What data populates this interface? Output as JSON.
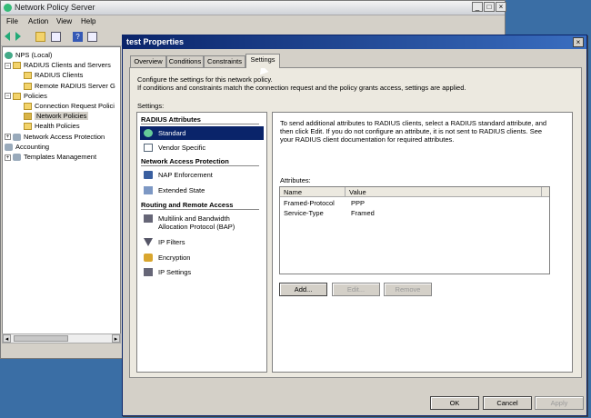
{
  "main_window": {
    "title": "Network Policy Server",
    "controls": {
      "minimize": "_",
      "maximize": "□",
      "close": "×"
    },
    "menu": [
      "File",
      "Action",
      "View",
      "Help"
    ],
    "tree": [
      {
        "label": "NPS (Local)",
        "icon": "server-icon",
        "expander": ""
      },
      {
        "label": "RADIUS Clients and Servers",
        "icon": "folder-icon",
        "expander": "−"
      },
      {
        "label": "RADIUS Clients",
        "icon": "folder-icon",
        "expander": ""
      },
      {
        "label": "Remote RADIUS Server G",
        "icon": "folder-icon",
        "expander": ""
      },
      {
        "label": "Policies",
        "icon": "folder-icon",
        "expander": "−"
      },
      {
        "label": "Connection Request Polici",
        "icon": "folder-icon",
        "expander": ""
      },
      {
        "label": "Network Policies",
        "icon": "folder-icon",
        "expander": ""
      },
      {
        "label": "Health Policies",
        "icon": "folder-icon",
        "expander": ""
      },
      {
        "label": "Network Access Protection",
        "icon": "gear-icon",
        "expander": "+"
      },
      {
        "label": "Accounting",
        "icon": "gear-icon",
        "expander": ""
      },
      {
        "label": "Templates Management",
        "icon": "gear-icon",
        "expander": "+"
      }
    ]
  },
  "dialog": {
    "title": "test Properties",
    "close": "×",
    "tabs": [
      "Overview",
      "Conditions",
      "Constraints",
      "Settings"
    ],
    "active_tab": "Settings",
    "intro_line1": "Configure the settings for this network policy.",
    "intro_line2": "If conditions and constraints match the connection request and the policy grants access, settings are applied.",
    "settings_label": "Settings:",
    "sections": [
      {
        "header": "RADIUS Attributes",
        "items": [
          {
            "label": "Standard",
            "icon": "globe-icon",
            "selected": true
          },
          {
            "label": "Vendor Specific",
            "icon": "checkbox-icon",
            "selected": false
          }
        ]
      },
      {
        "header": "Network Access Protection",
        "items": [
          {
            "label": "NAP Enforcement",
            "icon": "shield-icon",
            "selected": false
          },
          {
            "label": "Extended State",
            "icon": "monitor-icon",
            "selected": false
          }
        ]
      },
      {
        "header": "Routing and Remote Access",
        "items": [
          {
            "label": "Multilink and Bandwidth",
            "label2": "Allocation Protocol (BAP)",
            "icon": "network-icon",
            "selected": false
          },
          {
            "label": "IP Filters",
            "icon": "filter-icon",
            "selected": false
          },
          {
            "label": "Encryption",
            "icon": "lock-icon",
            "selected": false
          },
          {
            "label": "IP Settings",
            "icon": "network-icon",
            "selected": false
          }
        ]
      }
    ],
    "help_line1": "To send additional attributes to RADIUS clients, select a RADIUS standard attribute, and",
    "help_line2": "then click Edit. If you do not configure an attribute, it is not sent to RADIUS clients. See",
    "help_line3": "your RADIUS client documentation for required attributes.",
    "attributes_label": "Attributes:",
    "columns": [
      "Name",
      "Value"
    ],
    "rows": [
      {
        "name": "Framed-Protocol",
        "value": "PPP"
      },
      {
        "name": "Service-Type",
        "value": "Framed"
      }
    ],
    "buttons": {
      "add": "Add...",
      "edit": "Edit...",
      "remove": "Remove"
    },
    "footer": {
      "ok": "OK",
      "cancel": "Cancel",
      "apply": "Apply"
    }
  },
  "colors": {
    "selection": "#0a246a",
    "dialog_title": "#0a246a",
    "desktop": "#3a6ea5"
  }
}
